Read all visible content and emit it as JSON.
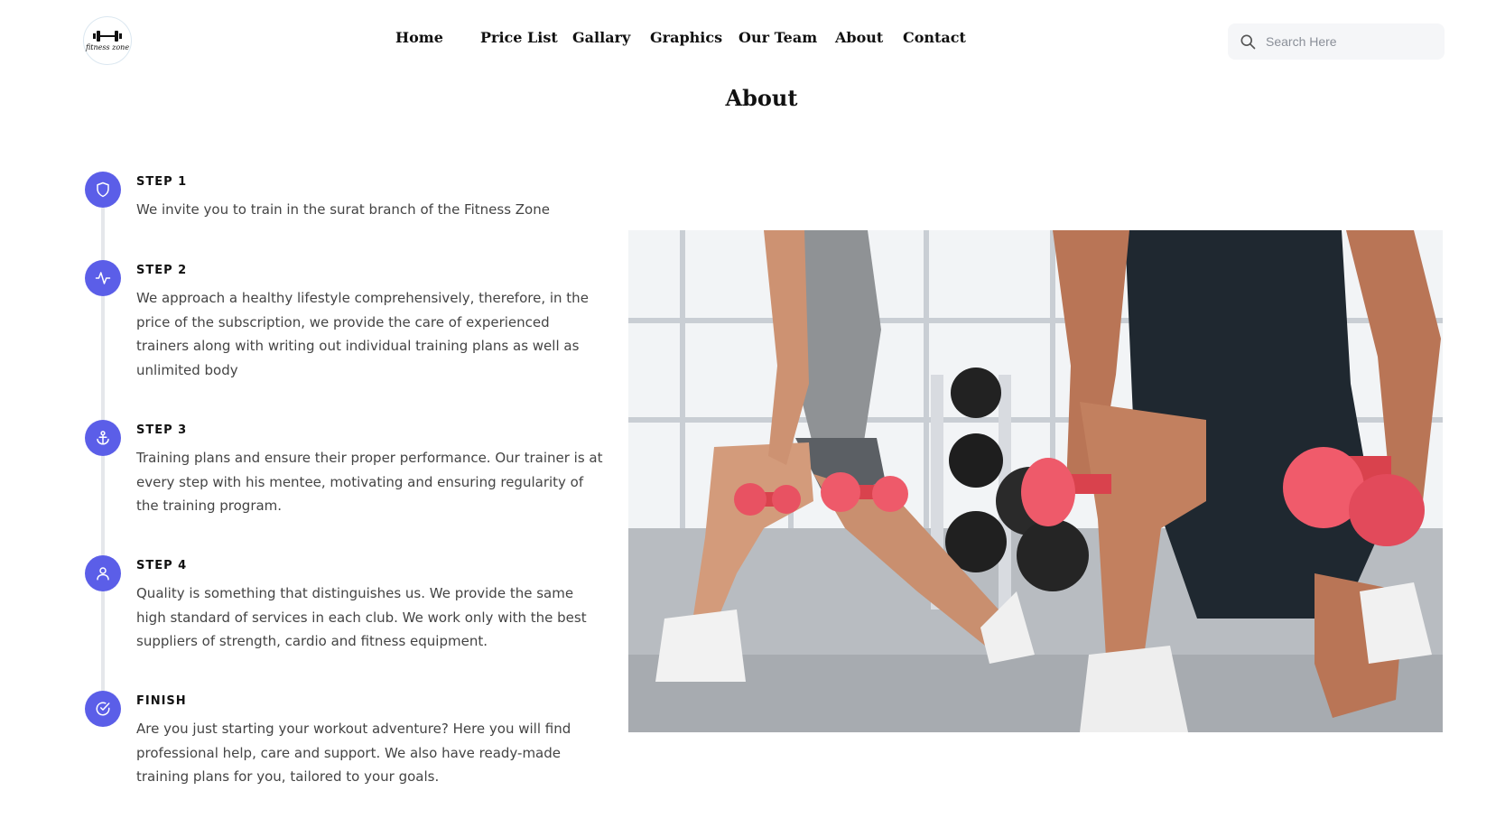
{
  "brand": {
    "logo_text": "fitness zone"
  },
  "nav": {
    "items": [
      {
        "label": "Home"
      },
      {
        "label": "Price List"
      },
      {
        "label": "Gallary"
      },
      {
        "label": "Graphics"
      },
      {
        "label": "Our Team"
      },
      {
        "label": "About"
      },
      {
        "label": "Contact"
      }
    ]
  },
  "search": {
    "placeholder": "Search Here",
    "icon": "search-icon"
  },
  "page": {
    "title": "About"
  },
  "colors": {
    "accent": "#5b5ee8",
    "timeline_line": "#e5e7eb"
  },
  "steps": [
    {
      "icon": "shield-icon",
      "label": "STEP 1",
      "text": "We invite you to train in the surat branch of the Fitness Zone"
    },
    {
      "icon": "activity-icon",
      "label": "STEP 2",
      "text": "We approach a healthy lifestyle comprehensively, therefore, in the price of the subscription, we provide the care of experienced trainers along with writing out individual training plans as well as unlimited body"
    },
    {
      "icon": "anchor-icon",
      "label": "STEP 3",
      "text": "Training plans and ensure their proper performance. Our trainer is at every step with his mentee, motivating and ensuring regularity of the training program."
    },
    {
      "icon": "user-icon",
      "label": "STEP 4",
      "text": "Quality is something that distinguishes us. We provide the same high standard of services in each club. We work only with the best suppliers of strength, cardio and fitness equipment."
    },
    {
      "icon": "check-circle-icon",
      "label": "FINISH",
      "text": "Are you just starting your workout adventure? Here you will find professional help, care and support. We also have ready-made training plans for you, tailored to your goals."
    }
  ]
}
